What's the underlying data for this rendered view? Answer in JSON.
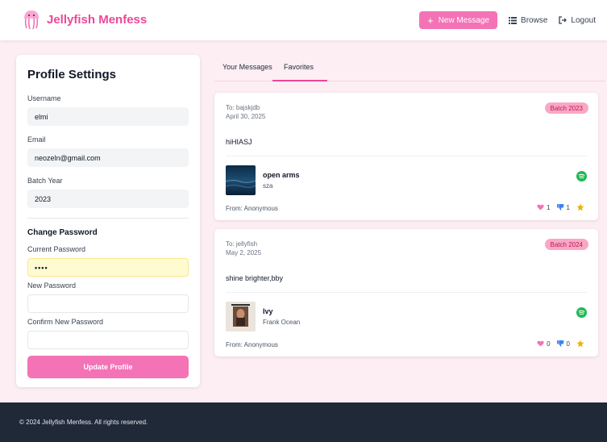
{
  "navbar": {
    "brand": "Jellyfish Menfess",
    "new_message": "New Message",
    "browse": "Browse",
    "logout": "Logout"
  },
  "profile": {
    "title": "Profile Settings",
    "username_label": "Username",
    "username": "elmi",
    "email_label": "Email",
    "email": "neozeln@gmail.com",
    "batch_label": "Batch Year",
    "batch": "2023",
    "change_password_title": "Change Password",
    "current_password_label": "Current Password",
    "current_password_mask": "••••",
    "new_password_label": "New Password",
    "confirm_password_label": "Confirm New Password",
    "update_button": "Update Profile"
  },
  "tabs": [
    {
      "label": "Your Messages",
      "active": false
    },
    {
      "label": "Favorites",
      "active": true
    }
  ],
  "messages": [
    {
      "to": "To: bajskjdb",
      "date": "April 30, 2025",
      "batch": "Batch 2023",
      "body": "hiHIASJ",
      "song_title": "open arms",
      "song_artist": "sza",
      "from": "From: Anonymous",
      "likes": "1",
      "dislikes": "1"
    },
    {
      "to": "To: jellyfish",
      "date": "May 2, 2025",
      "batch": "Batch 2024",
      "body": "shine brighter,bby",
      "song_title": "Ivy",
      "song_artist": "Frank Ocean",
      "from": "From: Anonymous",
      "likes": "0",
      "dislikes": "0"
    }
  ],
  "footer": {
    "text": "© 2024 Jellyfish Menfess. All rights reserved."
  },
  "colors": {
    "accent": "#ec4899",
    "button": "#f472b6",
    "page_bg": "#fdeef3",
    "footer_bg": "#1f2937",
    "spotify": "#1db954"
  }
}
